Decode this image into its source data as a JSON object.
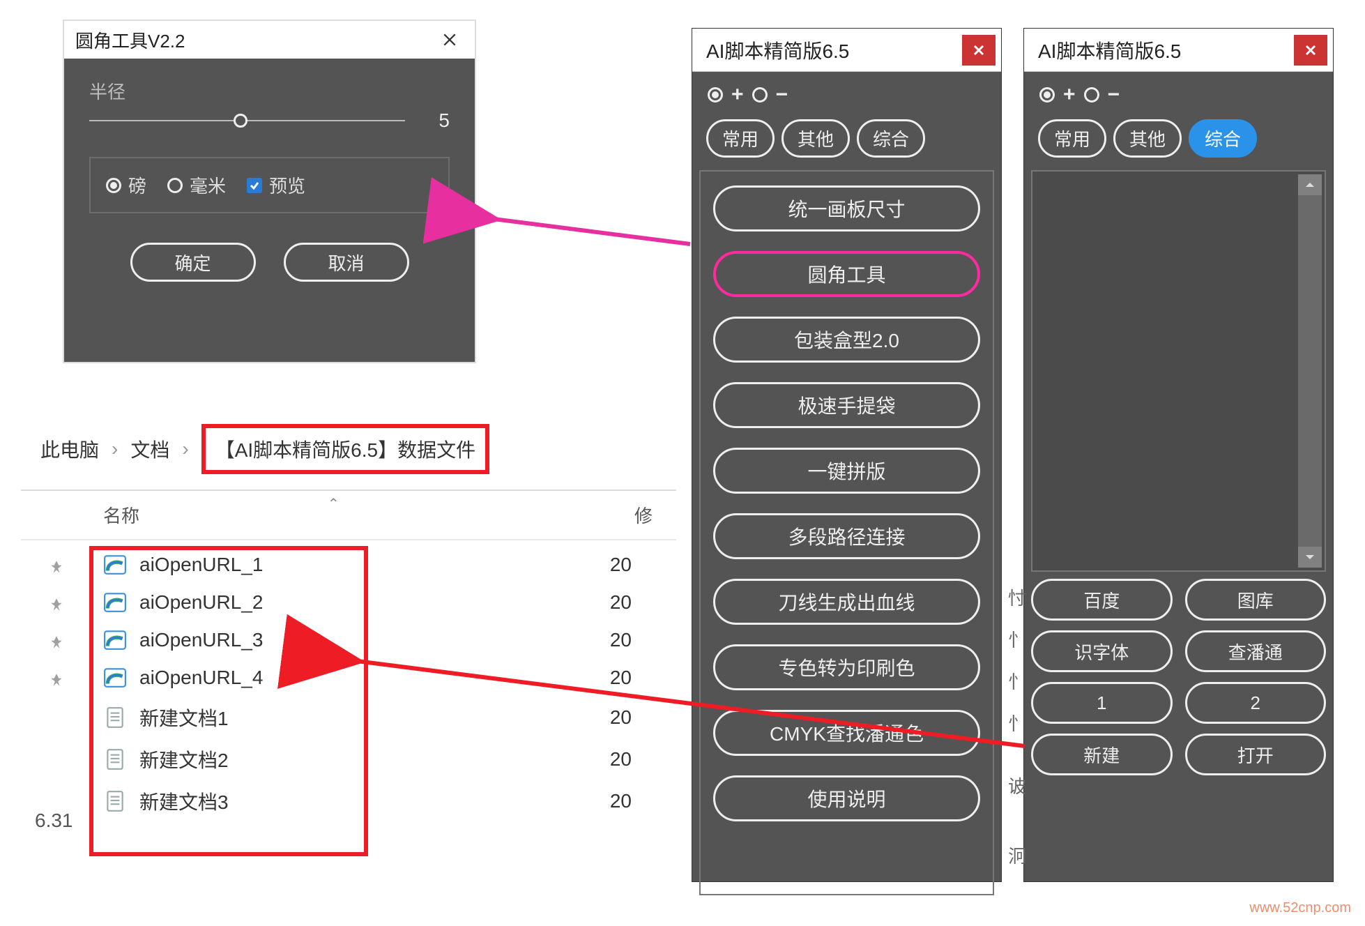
{
  "dialog": {
    "title": "圆角工具V2.2",
    "radius_label": "半径",
    "radius_value": "5",
    "unit_pound": "磅",
    "unit_mm": "毫米",
    "preview_label": "预览",
    "ok": "确定",
    "cancel": "取消"
  },
  "explorer": {
    "crumb1": "此电脑",
    "crumb2": "文档",
    "crumb3": "【AI脚本精简版6.5】数据文件",
    "col_name": "名称",
    "col_mod": "修",
    "version_fragment": "6.31",
    "files": [
      {
        "name": "aiOpenURL_1",
        "type": "edge",
        "mod": "20"
      },
      {
        "name": "aiOpenURL_2",
        "type": "edge",
        "mod": "20"
      },
      {
        "name": "aiOpenURL_3",
        "type": "edge",
        "mod": "20"
      },
      {
        "name": "aiOpenURL_4",
        "type": "edge",
        "mod": "20"
      },
      {
        "name": "新建文档1",
        "type": "txt",
        "mod": "20"
      },
      {
        "name": "新建文档2",
        "type": "txt",
        "mod": "20"
      },
      {
        "name": "新建文档3",
        "type": "txt",
        "mod": "20"
      }
    ]
  },
  "panel1": {
    "title": "AI脚本精简版6.5",
    "plus": "+",
    "minus": "−",
    "tabs": [
      "常用",
      "其他",
      "综合"
    ],
    "tools": [
      "统一画板尺寸",
      "圆角工具",
      "包装盒型2.0",
      "极速手提袋",
      "一键拼版",
      "多段路径连接",
      "刀线生成出血线",
      "专色转为印刷色",
      "CMYK查找潘通色",
      "使用说明"
    ]
  },
  "panel2": {
    "title": "AI脚本精简版6.5",
    "plus": "+",
    "minus": "−",
    "tabs": [
      "常用",
      "其他",
      "综合"
    ],
    "buttons": [
      "百度",
      "图库",
      "识字体",
      "查潘通",
      "1",
      "2",
      "新建",
      "打开"
    ]
  },
  "fragments": {
    "f1": "忖",
    "f2": "忄",
    "f3": "忄",
    "f4": "忄",
    "f5": "诐",
    "f6": "泂"
  },
  "watermark": "www.52cnp.com"
}
